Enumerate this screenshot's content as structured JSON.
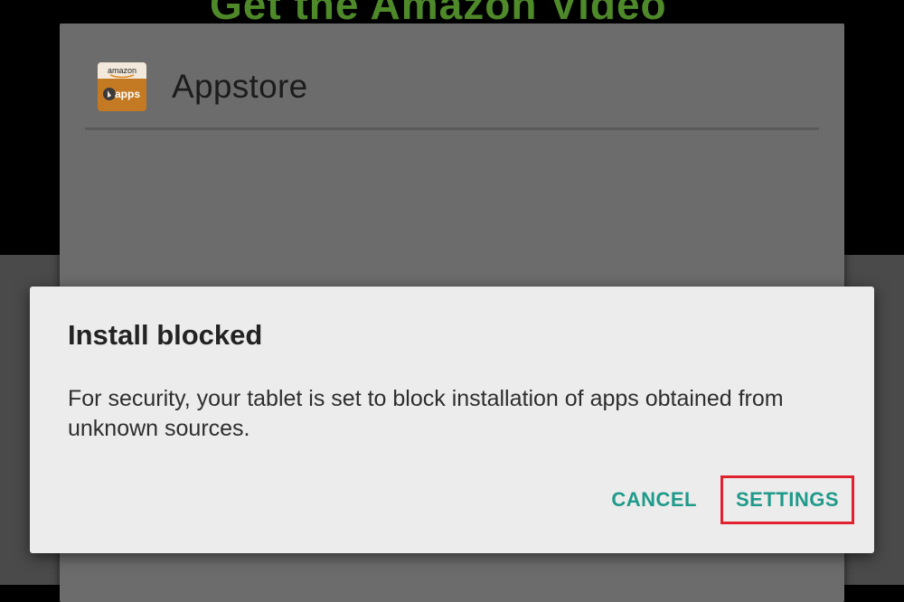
{
  "background": {
    "heading_fragment": "Get the Amazon Video"
  },
  "app": {
    "name": "Appstore",
    "icon": "amazon-appstore-icon",
    "icon_text_top": "amazon",
    "icon_text_bottom": "apps"
  },
  "dialog": {
    "title": "Install blocked",
    "message": "For security, your tablet is set to block installation of apps obtained from unknown sources.",
    "cancel_label": "CANCEL",
    "settings_label": "SETTINGS"
  },
  "colors": {
    "accent": "#1f9a8a",
    "highlight_border": "#e0222e",
    "dialog_background": "#ececec",
    "overlay": "#6c6c6c"
  }
}
